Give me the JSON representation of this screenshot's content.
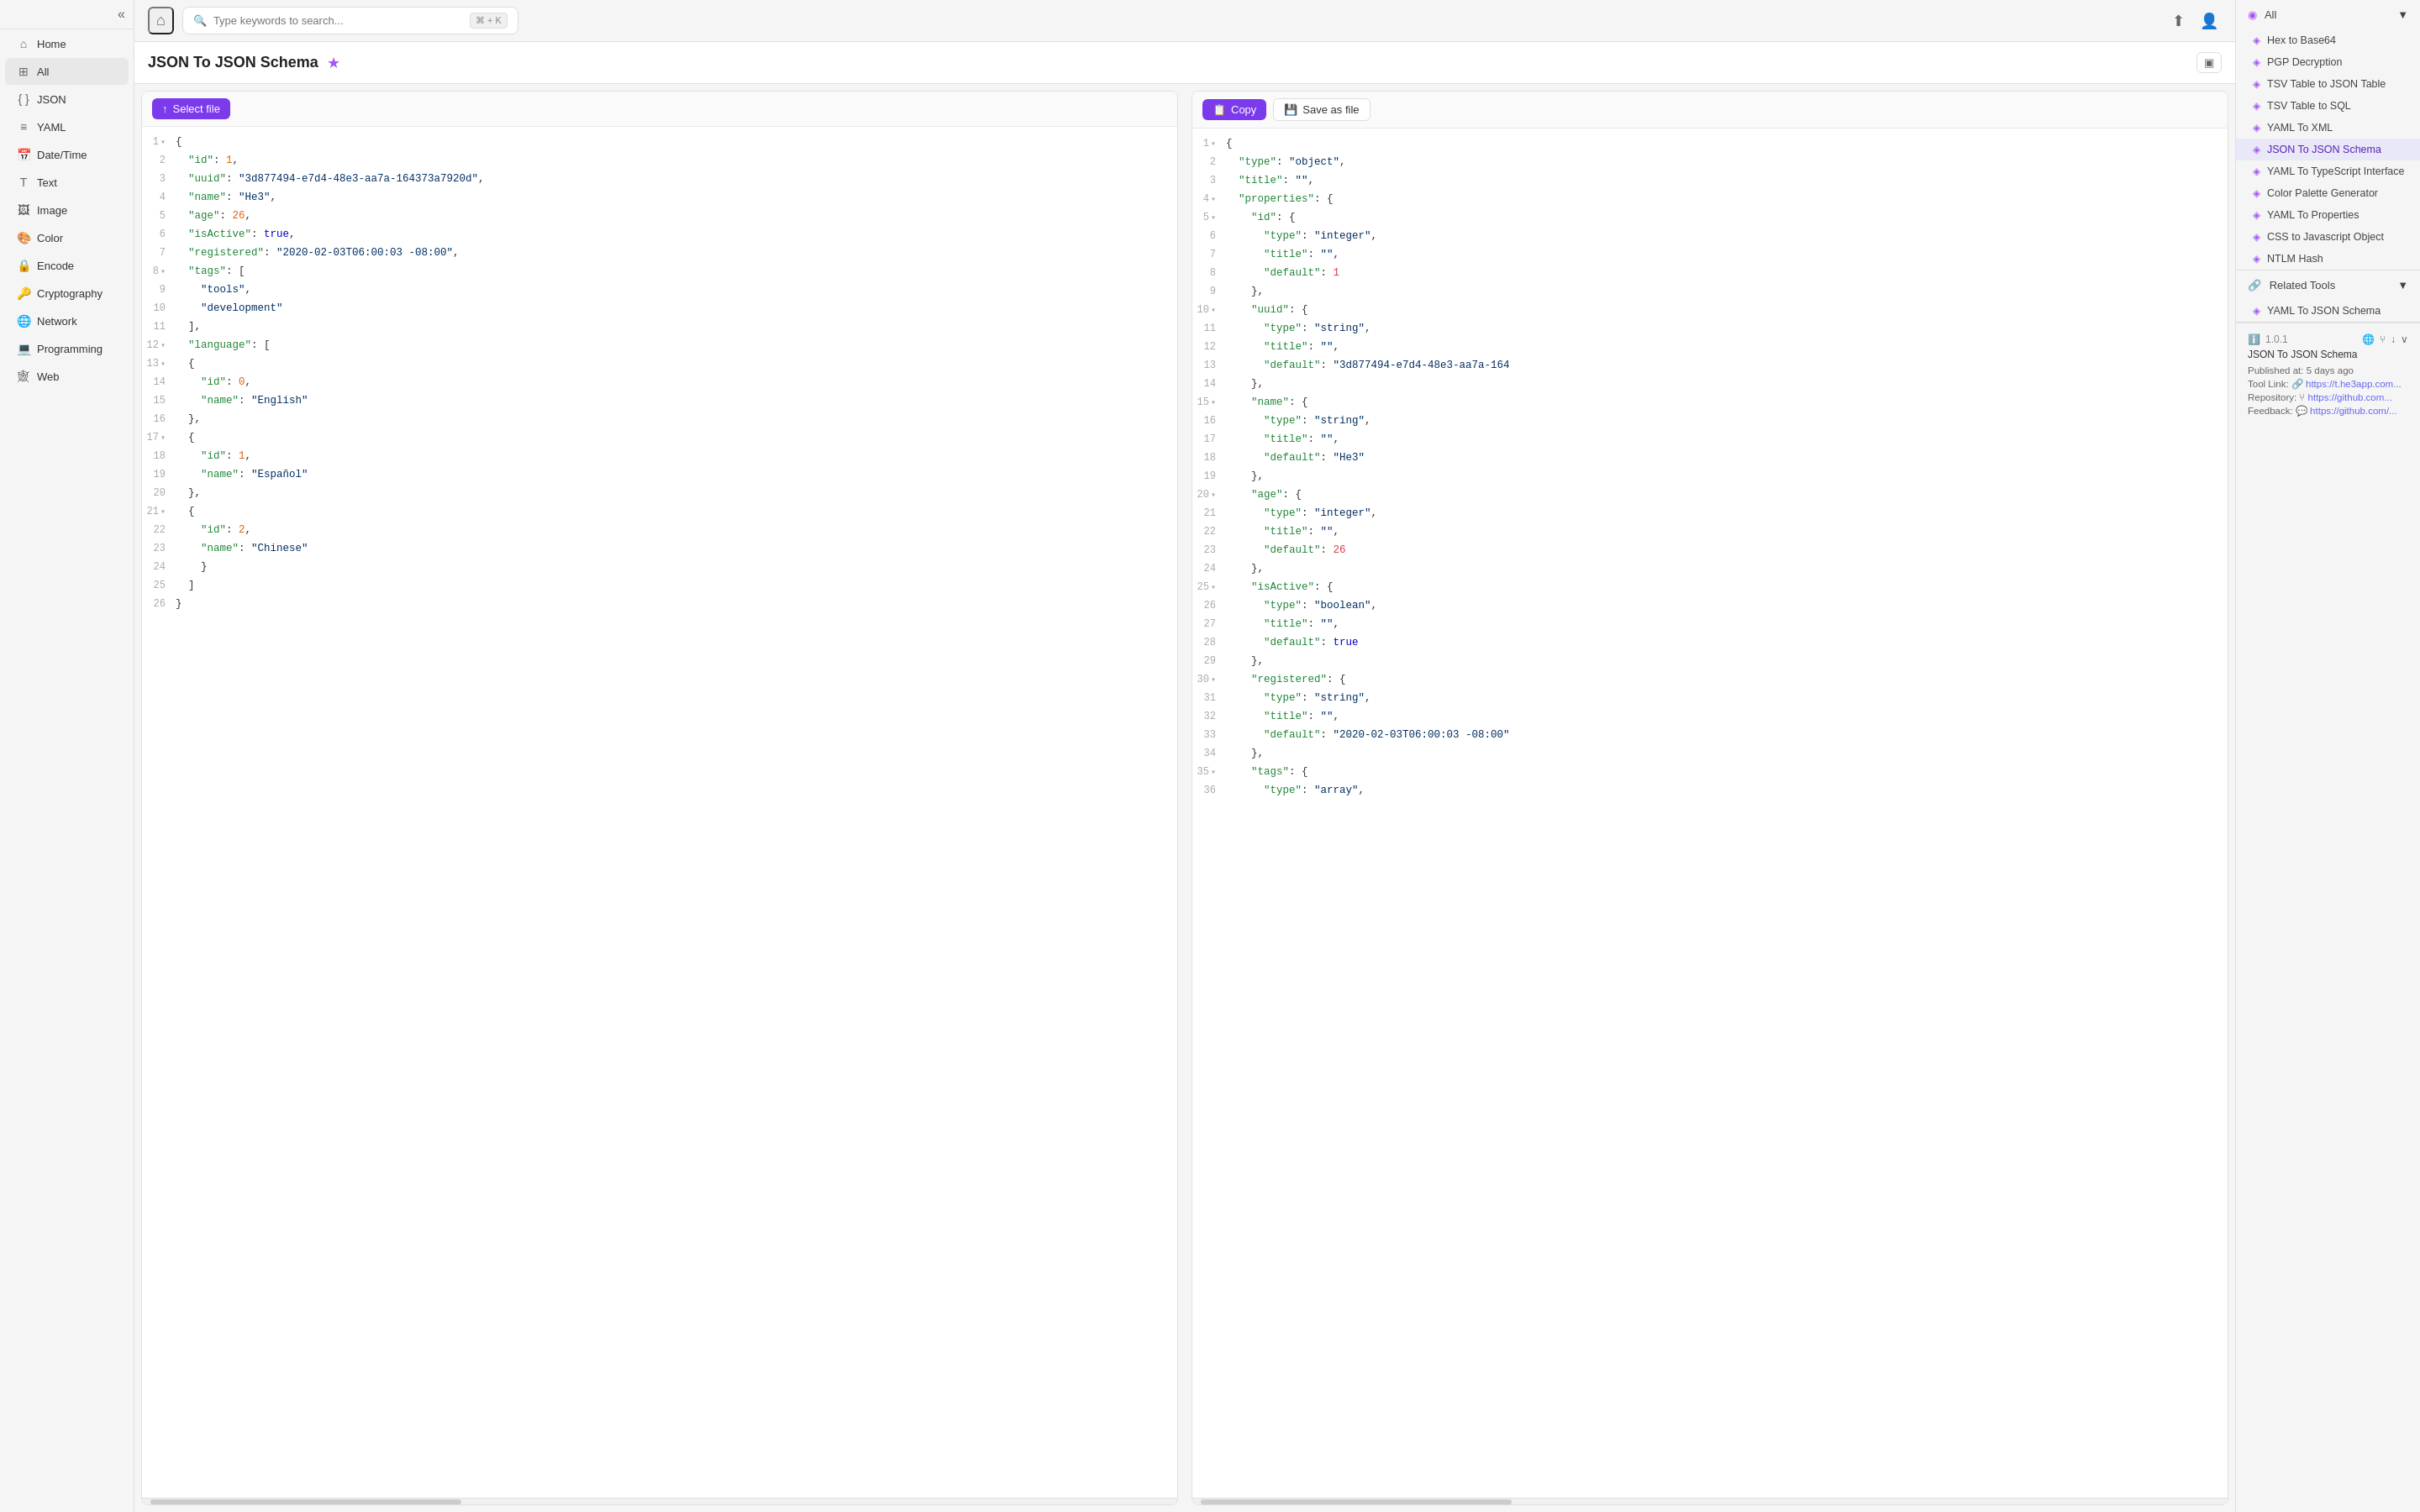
{
  "sidebar": {
    "toggle_icon": "«",
    "items": [
      {
        "id": "home",
        "label": "Home",
        "icon": "⌂"
      },
      {
        "id": "all",
        "label": "All",
        "icon": "⊞",
        "active": true
      },
      {
        "id": "json",
        "label": "JSON",
        "icon": "{ }"
      },
      {
        "id": "yaml",
        "label": "YAML",
        "icon": "≡"
      },
      {
        "id": "datetime",
        "label": "Date/Time",
        "icon": "📅"
      },
      {
        "id": "text",
        "label": "Text",
        "icon": "T"
      },
      {
        "id": "image",
        "label": "Image",
        "icon": "🖼"
      },
      {
        "id": "color",
        "label": "Color",
        "icon": "🎨"
      },
      {
        "id": "encode",
        "label": "Encode",
        "icon": "🔒"
      },
      {
        "id": "cryptography",
        "label": "Cryptography",
        "icon": "🔑"
      },
      {
        "id": "network",
        "label": "Network",
        "icon": "🌐"
      },
      {
        "id": "programming",
        "label": "Programming",
        "icon": "💻"
      },
      {
        "id": "web",
        "label": "Web",
        "icon": "🕸"
      }
    ]
  },
  "topbar": {
    "search_placeholder": "Type keywords to search...",
    "search_shortcut": "⌘ + K",
    "home_icon": "⌂",
    "share_icon": "⬆",
    "user_icon": "👤"
  },
  "tool": {
    "title": "JSON To JSON Schema",
    "favorite_icon": "★",
    "layout_icon": "▣"
  },
  "left_panel": {
    "select_file_btn": "Select file",
    "lines": [
      {
        "num": "1",
        "content": "{",
        "collapse": true
      },
      {
        "num": "2",
        "content": "  \"id\": 1,",
        "key": "id",
        "val": "1"
      },
      {
        "num": "3",
        "content": "  \"uuid\": \"3d877494-e7d4-48e3-aa7a-164373a7920d\",",
        "key": "uuid"
      },
      {
        "num": "4",
        "content": "  \"name\": \"He3\",",
        "key": "name"
      },
      {
        "num": "5",
        "content": "  \"age\": 26,",
        "key": "age"
      },
      {
        "num": "6",
        "content": "  \"isActive\": true,",
        "key": "isActive"
      },
      {
        "num": "7",
        "content": "  \"registered\": \"2020-02-03T06:00:03 -08:00\",",
        "key": "registered"
      },
      {
        "num": "8",
        "content": "  \"tags\": [",
        "collapse": true,
        "key": "tags"
      },
      {
        "num": "9",
        "content": "    \"tools\",",
        "key": null
      },
      {
        "num": "10",
        "content": "    \"development\"",
        "key": null
      },
      {
        "num": "11",
        "content": "  ],",
        "key": null
      },
      {
        "num": "12",
        "content": "  \"language\": [",
        "collapse": true,
        "key": "language"
      },
      {
        "num": "13",
        "content": "  {",
        "collapse": true
      },
      {
        "num": "14",
        "content": "    \"id\": 0,",
        "key": "id"
      },
      {
        "num": "15",
        "content": "    \"name\": \"English\"",
        "key": "name"
      },
      {
        "num": "16",
        "content": "  },",
        "key": null
      },
      {
        "num": "17",
        "content": "  {",
        "collapse": true
      },
      {
        "num": "18",
        "content": "    \"id\": 1,",
        "key": "id"
      },
      {
        "num": "19",
        "content": "    \"name\": \"Español\"",
        "key": "name"
      },
      {
        "num": "20",
        "content": "  },",
        "key": null
      },
      {
        "num": "21",
        "content": "  {",
        "collapse": true
      },
      {
        "num": "22",
        "content": "    \"id\": 2,",
        "key": "id"
      },
      {
        "num": "23",
        "content": "    \"name\": \"Chinese\"",
        "key": "name"
      },
      {
        "num": "24",
        "content": "    }",
        "key": null
      },
      {
        "num": "25",
        "content": "  ]",
        "key": null
      },
      {
        "num": "26",
        "content": "}",
        "key": null
      }
    ]
  },
  "right_panel": {
    "copy_btn": "Copy",
    "save_btn": "Save as file",
    "lines": [
      {
        "num": "1",
        "content": "{",
        "collapse": true
      },
      {
        "num": "2",
        "content": "  \"type\": \"object\","
      },
      {
        "num": "3",
        "content": "  \"title\": \"\","
      },
      {
        "num": "4",
        "content": "  \"properties\": {",
        "collapse": true
      },
      {
        "num": "5",
        "content": "    \"id\": {",
        "collapse": true
      },
      {
        "num": "6",
        "content": "      \"type\": \"integer\","
      },
      {
        "num": "7",
        "content": "      \"title\": \"\","
      },
      {
        "num": "8",
        "content": "      \"default\": 1"
      },
      {
        "num": "9",
        "content": "    },"
      },
      {
        "num": "10",
        "content": "    \"uuid\": {",
        "collapse": true
      },
      {
        "num": "11",
        "content": "      \"type\": \"string\","
      },
      {
        "num": "12",
        "content": "      \"title\": \"\","
      },
      {
        "num": "13",
        "content": "      \"default\": \"3d877494-e7d4-48e3-aa7a-164"
      },
      {
        "num": "14",
        "content": "    },"
      },
      {
        "num": "15",
        "content": "    \"name\": {",
        "collapse": true
      },
      {
        "num": "16",
        "content": "      \"type\": \"string\","
      },
      {
        "num": "17",
        "content": "      \"title\": \"\","
      },
      {
        "num": "18",
        "content": "      \"default\": \"He3\""
      },
      {
        "num": "19",
        "content": "    },"
      },
      {
        "num": "20",
        "content": "    \"age\": {",
        "collapse": true
      },
      {
        "num": "21",
        "content": "      \"type\": \"integer\","
      },
      {
        "num": "22",
        "content": "      \"title\": \"\","
      },
      {
        "num": "23",
        "content": "      \"default\": 26"
      },
      {
        "num": "24",
        "content": "    },"
      },
      {
        "num": "25",
        "content": "    \"isActive\": {",
        "collapse": true
      },
      {
        "num": "26",
        "content": "      \"type\": \"boolean\","
      },
      {
        "num": "27",
        "content": "      \"title\": \"\","
      },
      {
        "num": "28",
        "content": "      \"default\": true"
      },
      {
        "num": "29",
        "content": "    },"
      },
      {
        "num": "30",
        "content": "    \"registered\": {",
        "collapse": true
      },
      {
        "num": "31",
        "content": "      \"type\": \"string\","
      },
      {
        "num": "32",
        "content": "      \"title\": \"\","
      },
      {
        "num": "33",
        "content": "      \"default\": \"2020-02-03T06:00:03 -08:00\""
      },
      {
        "num": "34",
        "content": "    },"
      },
      {
        "num": "35",
        "content": "    \"tags\": {",
        "collapse": true
      },
      {
        "num": "36",
        "content": "      \"type\": \"array\","
      }
    ]
  },
  "right_sidebar": {
    "all_section": {
      "label": "All",
      "icon": "◉",
      "items": [
        {
          "id": "hex-to-base64",
          "label": "Hex to Base64",
          "icon": "◈"
        },
        {
          "id": "pgp-decryption",
          "label": "PGP Decryption",
          "icon": "◈"
        },
        {
          "id": "tsv-to-json",
          "label": "TSV Table to JSON Table",
          "icon": "◈"
        },
        {
          "id": "tsv-to-sql",
          "label": "TSV Table to SQL",
          "icon": "◈"
        },
        {
          "id": "yaml-to-xml",
          "label": "YAML To XML",
          "icon": "◈"
        },
        {
          "id": "json-to-schema",
          "label": "JSON To JSON Schema",
          "icon": "◈",
          "active": true
        },
        {
          "id": "yaml-to-ts",
          "label": "YAML To TypeScript Interface",
          "icon": "◈"
        },
        {
          "id": "color-palette",
          "label": "Color Palette Generator",
          "icon": "◈"
        },
        {
          "id": "yaml-to-props",
          "label": "YAML To Properties",
          "icon": "◈"
        },
        {
          "id": "css-to-js",
          "label": "CSS to Javascript Object",
          "icon": "◈"
        },
        {
          "id": "ntlm-hash",
          "label": "NTLM Hash",
          "icon": "◈"
        }
      ]
    },
    "related_section": {
      "label": "Related Tools",
      "icon": "🔗",
      "items": [
        {
          "id": "yaml-to-json",
          "label": "YAML To JSON Schema",
          "icon": "◈"
        }
      ]
    },
    "version": {
      "number": "1.0.1",
      "tool_name": "JSON To JSON Schema",
      "published": "Published at: 5 days ago",
      "tool_link_label": "Tool Link:",
      "tool_link": "https://t.he3app.com...",
      "repo_label": "Repository:",
      "repo_link": "https://github.com...",
      "feedback_label": "Feedback:",
      "feedback_link": "https://github.com/..."
    }
  }
}
